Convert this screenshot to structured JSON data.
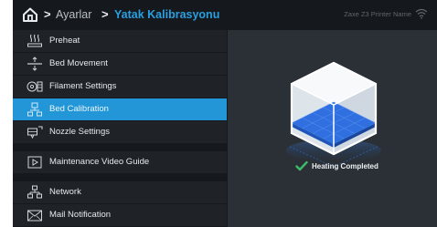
{
  "header": {
    "breadcrumb_sep": ">",
    "parent": "Ayarlar",
    "current": "Yatak Kalibrasyonu",
    "printer_name": "Zaxe Z3 Printer Name"
  },
  "menu": {
    "items": [
      {
        "label": "Preheat",
        "icon": "preheat-icon"
      },
      {
        "label": "Bed Movement",
        "icon": "bed-movement-icon"
      },
      {
        "label": "Filament Settings",
        "icon": "filament-icon"
      },
      {
        "label": "Bed Calibration",
        "icon": "bed-calibration-icon",
        "active": true
      },
      {
        "label": "Nozzle Settings",
        "icon": "nozzle-icon"
      },
      {
        "label": "Maintenance Video Guide",
        "icon": "video-icon"
      },
      {
        "label": "Network",
        "icon": "network-icon"
      },
      {
        "label": "Mail Notification",
        "icon": "mail-icon"
      }
    ]
  },
  "panel": {
    "status": "Heating Completed"
  },
  "colors": {
    "accent": "#2396d8",
    "breadcrumb_current": "#2a9fe0",
    "success": "#3dbb6a",
    "bed_blue": "#2f6fe0"
  }
}
